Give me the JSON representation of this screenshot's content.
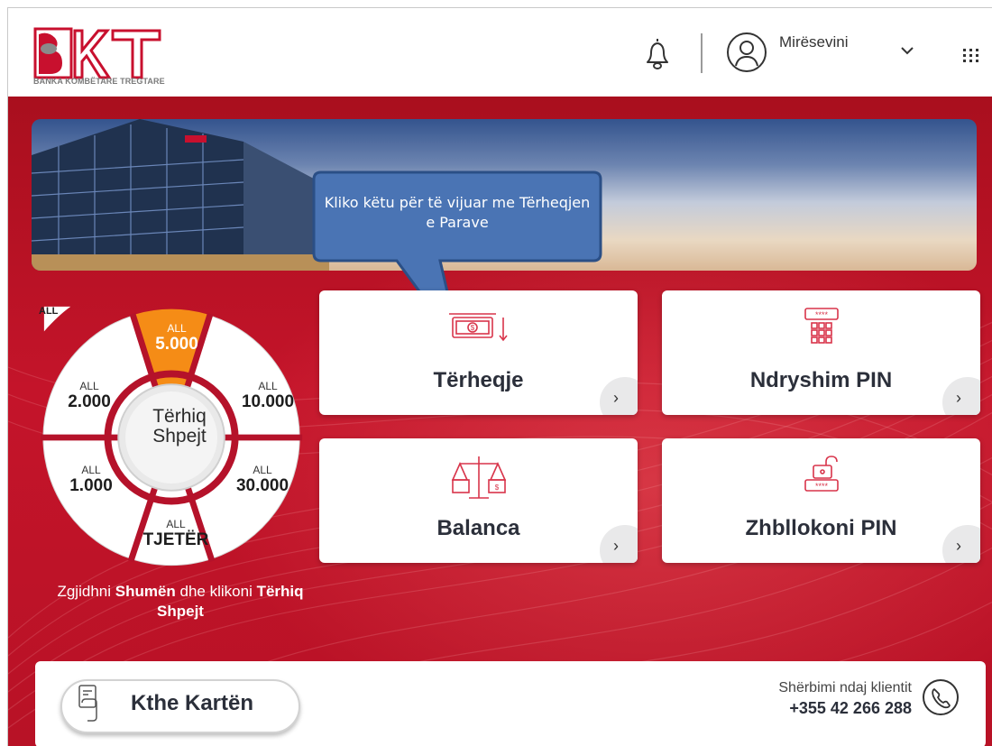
{
  "header": {
    "logo_text": "BKT",
    "logo_subtitle": "BANKA KOMBËTARE TREGTARE",
    "welcome_label": "Mirësevini"
  },
  "callout": {
    "text": "Kliko këtu për të vijuar me Tërheqjen e Parave"
  },
  "quick_withdraw": {
    "currency_badge": "ALL",
    "center_label_line1": "Tërhiq",
    "center_label_line2": "Shpejt",
    "options": [
      {
        "currency": "ALL",
        "amount": "5.000",
        "selected": true
      },
      {
        "currency": "ALL",
        "amount": "10.000"
      },
      {
        "currency": "ALL",
        "amount": "30.000"
      },
      {
        "currency": "ALL",
        "amount": "TJETËR"
      },
      {
        "currency": "ALL",
        "amount": "1.000"
      },
      {
        "currency": "ALL",
        "amount": "2.000"
      }
    ],
    "caption_part1": "Zgjidhni ",
    "caption_bold1": "Shumën",
    "caption_part2": " dhe klikoni ",
    "caption_bold2": "Tërhiq Shpejt"
  },
  "cards": [
    {
      "label": "Tërheqje",
      "icon": "cash-withdraw-icon"
    },
    {
      "label": "Ndryshim PIN",
      "icon": "pin-keypad-icon"
    },
    {
      "label": "Balanca",
      "icon": "balance-scale-icon"
    },
    {
      "label": "Zhbllokoni PIN",
      "icon": "unlock-pin-icon"
    }
  ],
  "card_arrow": "›",
  "footer": {
    "return_card_label": "Kthe Kartën",
    "service_label": "Shërbimi ndaj klientit",
    "service_phone": "+355 42 266 288"
  },
  "colors": {
    "brand_red": "#c4142a",
    "selected_orange": "#f28a14",
    "card_text": "#2b2f3a",
    "callout_blue": "#4a74b4"
  }
}
